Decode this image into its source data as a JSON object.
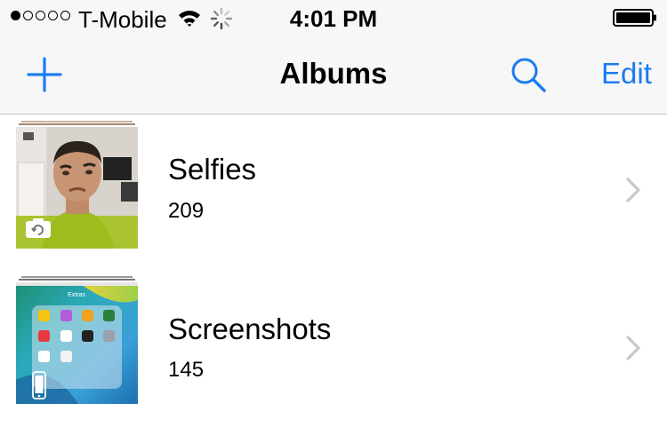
{
  "status_bar": {
    "carrier": "T-Mobile",
    "signal_bars_filled": 1,
    "signal_bars_total": 5,
    "time": "4:01 PM"
  },
  "nav": {
    "title": "Albums",
    "edit_label": "Edit",
    "accent_color": "#1b7cf0"
  },
  "albums": [
    {
      "title": "Selfies",
      "count": "209",
      "badge_icon": "front-camera-rotate-icon"
    },
    {
      "title": "Screenshots",
      "count": "145",
      "badge_icon": "iphone-icon",
      "thumb_folder_label": "Extras"
    }
  ]
}
